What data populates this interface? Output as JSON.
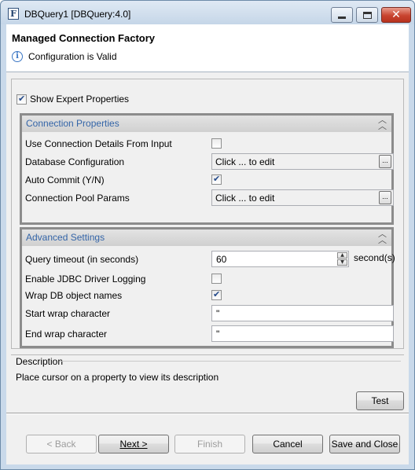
{
  "window": {
    "title": "DBQuery1 [DBQuery:4.0]",
    "app_icon_letter": "F"
  },
  "header": {
    "title": "Managed Connection Factory",
    "status": "Configuration is Valid"
  },
  "show_expert": {
    "label": "Show Expert Properties",
    "checked": true
  },
  "connection_group": {
    "title": "Connection Properties",
    "use_conn_details": {
      "label": "Use Connection Details From Input",
      "checked": false
    },
    "db_config": {
      "label": "Database Configuration",
      "value": "Click ... to edit",
      "button": "..."
    },
    "auto_commit": {
      "label": "Auto Commit (Y/N)",
      "checked": true
    },
    "pool_params": {
      "label": "Connection Pool Params",
      "value": "Click ... to edit",
      "button": "..."
    }
  },
  "advanced_group": {
    "title": "Advanced Settings",
    "query_timeout": {
      "label": "Query timeout (in seconds)",
      "value": "60",
      "unit": "second(s)"
    },
    "jdbc_logging": {
      "label": "Enable JDBC Driver Logging",
      "checked": false
    },
    "wrap_names": {
      "label": "Wrap DB object names",
      "checked": true
    },
    "start_wrap": {
      "label": "Start wrap character",
      "value": "\""
    },
    "end_wrap": {
      "label": "End wrap character",
      "value": "\""
    }
  },
  "description": {
    "title": "Description",
    "text": "Place cursor on a property to view its description"
  },
  "buttons": {
    "test": "Test",
    "back": "< Back",
    "next": "Next >",
    "finish": "Finish",
    "cancel": "Cancel",
    "save_close": "Save and Close"
  },
  "icons": {
    "info": "info-icon",
    "collapse": "double-chevron-up-icon"
  }
}
